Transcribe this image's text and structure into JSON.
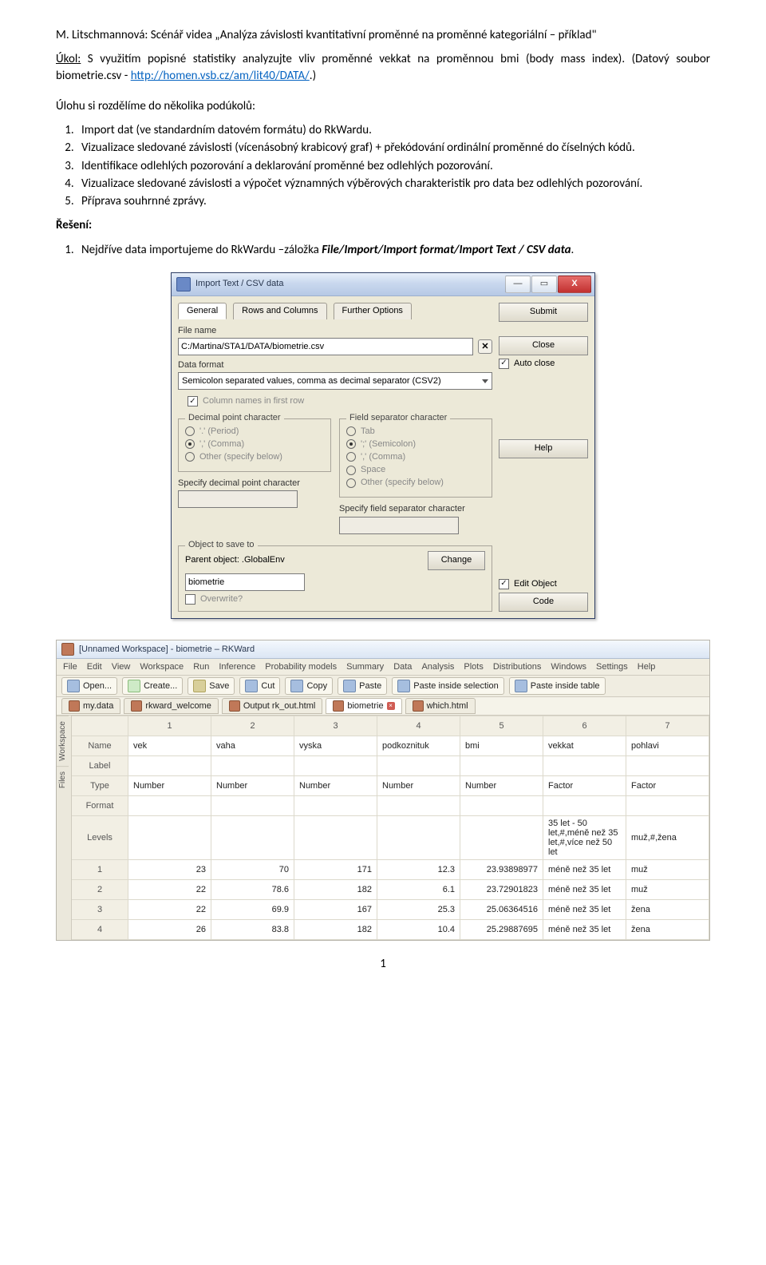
{
  "doc": {
    "heading": "M. Litschmannová: Scénář videa „Analýza závislosti kvantitativní proměnné na proměnné kategoriální – příklad\"",
    "ukol_label": "Úkol:",
    "ukol_text": " S využitím popisné statistiky analyzujte vliv proměnné vekkat na proměnnou bmi (body mass index). (Datový soubor biometrie.csv - ",
    "link": "http://homen.vsb.cz/am/lit40/DATA/",
    "ukol_tail": ".)",
    "subtask_intro": "Úlohu si rozdělíme do několika podúkolů:",
    "subtasks": [
      "Import dat (ve standardním datovém formátu) do RkWardu.",
      "Vizualizace sledované závislosti (vícenásobný krabicový graf) + překódování ordinální proměnné do číselných kódů.",
      "Identifikace odlehlých pozorování a deklarování proměnné bez odlehlých pozorování.",
      "Vizualizace sledované závislosti a výpočet významných výběrových charakteristik pro data bez odlehlých pozorování.",
      "Příprava souhrnné zprávy."
    ],
    "reseni_label": "Řešení:",
    "reseni_item_pre": "Nejdříve data importujeme do RkWardu –záložka ",
    "reseni_item_bold": "File/Import/Import format/Import Text / CSV data",
    "reseni_item_tail": ".",
    "pagenum": "1"
  },
  "dialog": {
    "title": "Import Text / CSV data",
    "tabs": [
      "General",
      "Rows and Columns",
      "Further Options"
    ],
    "fileLabel": "File name",
    "fileValue": "C:/Martina/STA1/DATA/biometrie.csv",
    "dataFormatLabel": "Data format",
    "dataFormatValue": "Semicolon separated values, comma as decimal separator (CSV2)",
    "colNamesFirst": "Column names in first row",
    "dec": {
      "legend": "Decimal point character",
      "opts": [
        "'.' (Period)",
        "',' (Comma)",
        "Other (specify below)"
      ],
      "spec": "Specify decimal point character"
    },
    "fs": {
      "legend": "Field separator character",
      "opts": [
        "Tab",
        "';' (Semicolon)",
        "',' (Comma)",
        "Space",
        "Other (specify below)"
      ],
      "spec": "Specify field separator character"
    },
    "save": {
      "legend": "Object to save to",
      "parent": "Parent object: .GlobalEnv",
      "change": "Change",
      "value": "biometrie",
      "overwrite": "Overwrite?",
      "editObj": "Edit Object"
    },
    "side": {
      "submit": "Submit",
      "close": "Close",
      "autoclose": "Auto close",
      "help": "Help",
      "code": "Code"
    }
  },
  "rk": {
    "title": "[Unnamed Workspace] - biometrie – RKWard",
    "menus": [
      "File",
      "Edit",
      "View",
      "Workspace",
      "Run",
      "Inference",
      "Probability models",
      "Summary",
      "Data",
      "Analysis",
      "Plots",
      "Distributions",
      "Windows",
      "Settings",
      "Help"
    ],
    "tools": [
      {
        "icon": "a",
        "label": "Open..."
      },
      {
        "icon": "c",
        "label": "Create..."
      },
      {
        "icon": "b",
        "label": "Save"
      },
      {
        "icon": "a",
        "label": "Cut"
      },
      {
        "icon": "a",
        "label": "Copy"
      },
      {
        "icon": "a",
        "label": "Paste"
      },
      {
        "icon": "a",
        "label": "Paste inside selection"
      },
      {
        "icon": "a",
        "label": "Paste inside table"
      }
    ],
    "tabs": [
      {
        "label": "my.data",
        "icon": "ri"
      },
      {
        "label": "rkward_welcome",
        "icon": "ri"
      },
      {
        "label": "Output rk_out.html",
        "icon": "ri"
      },
      {
        "label": "biometrie",
        "icon": "ri",
        "active": true,
        "x": true
      },
      {
        "label": "which.html",
        "icon": "ri"
      }
    ],
    "sideTabs": [
      "Workspace",
      "Files"
    ],
    "colnums": [
      "",
      "1",
      "2",
      "3",
      "4",
      "5",
      "6",
      "7"
    ],
    "meta": [
      {
        "l": "Name",
        "v": [
          "vek",
          "vaha",
          "vyska",
          "podkoznituk",
          "bmi",
          "vekkat",
          "pohlavi"
        ]
      },
      {
        "l": "Label",
        "v": [
          "",
          "",
          "",
          "",
          "",
          "",
          ""
        ]
      },
      {
        "l": "Type",
        "v": [
          "Number",
          "Number",
          "Number",
          "Number",
          "Number",
          "Factor",
          "Factor"
        ]
      },
      {
        "l": "Format",
        "v": [
          "",
          "",
          "",
          "",
          "",
          "",
          ""
        ]
      },
      {
        "l": "Levels",
        "v": [
          "",
          "",
          "",
          "",
          "",
          "35 let - 50 let,#,méně než 35 let,#,více než 50 let",
          "muž,#,žena"
        ]
      }
    ],
    "rows": [
      {
        "n": "1",
        "v": [
          "23",
          "70",
          "171",
          "12.3",
          "23.93898977",
          "méně než 35 let",
          "muž"
        ]
      },
      {
        "n": "2",
        "v": [
          "22",
          "78.6",
          "182",
          "6.1",
          "23.72901823",
          "méně než 35 let",
          "muž"
        ]
      },
      {
        "n": "3",
        "v": [
          "22",
          "69.9",
          "167",
          "25.3",
          "25.06364516",
          "méně než 35 let",
          "žena"
        ]
      },
      {
        "n": "4",
        "v": [
          "26",
          "83.8",
          "182",
          "10.4",
          "25.29887695",
          "méně než 35 let",
          "žena"
        ]
      }
    ]
  }
}
